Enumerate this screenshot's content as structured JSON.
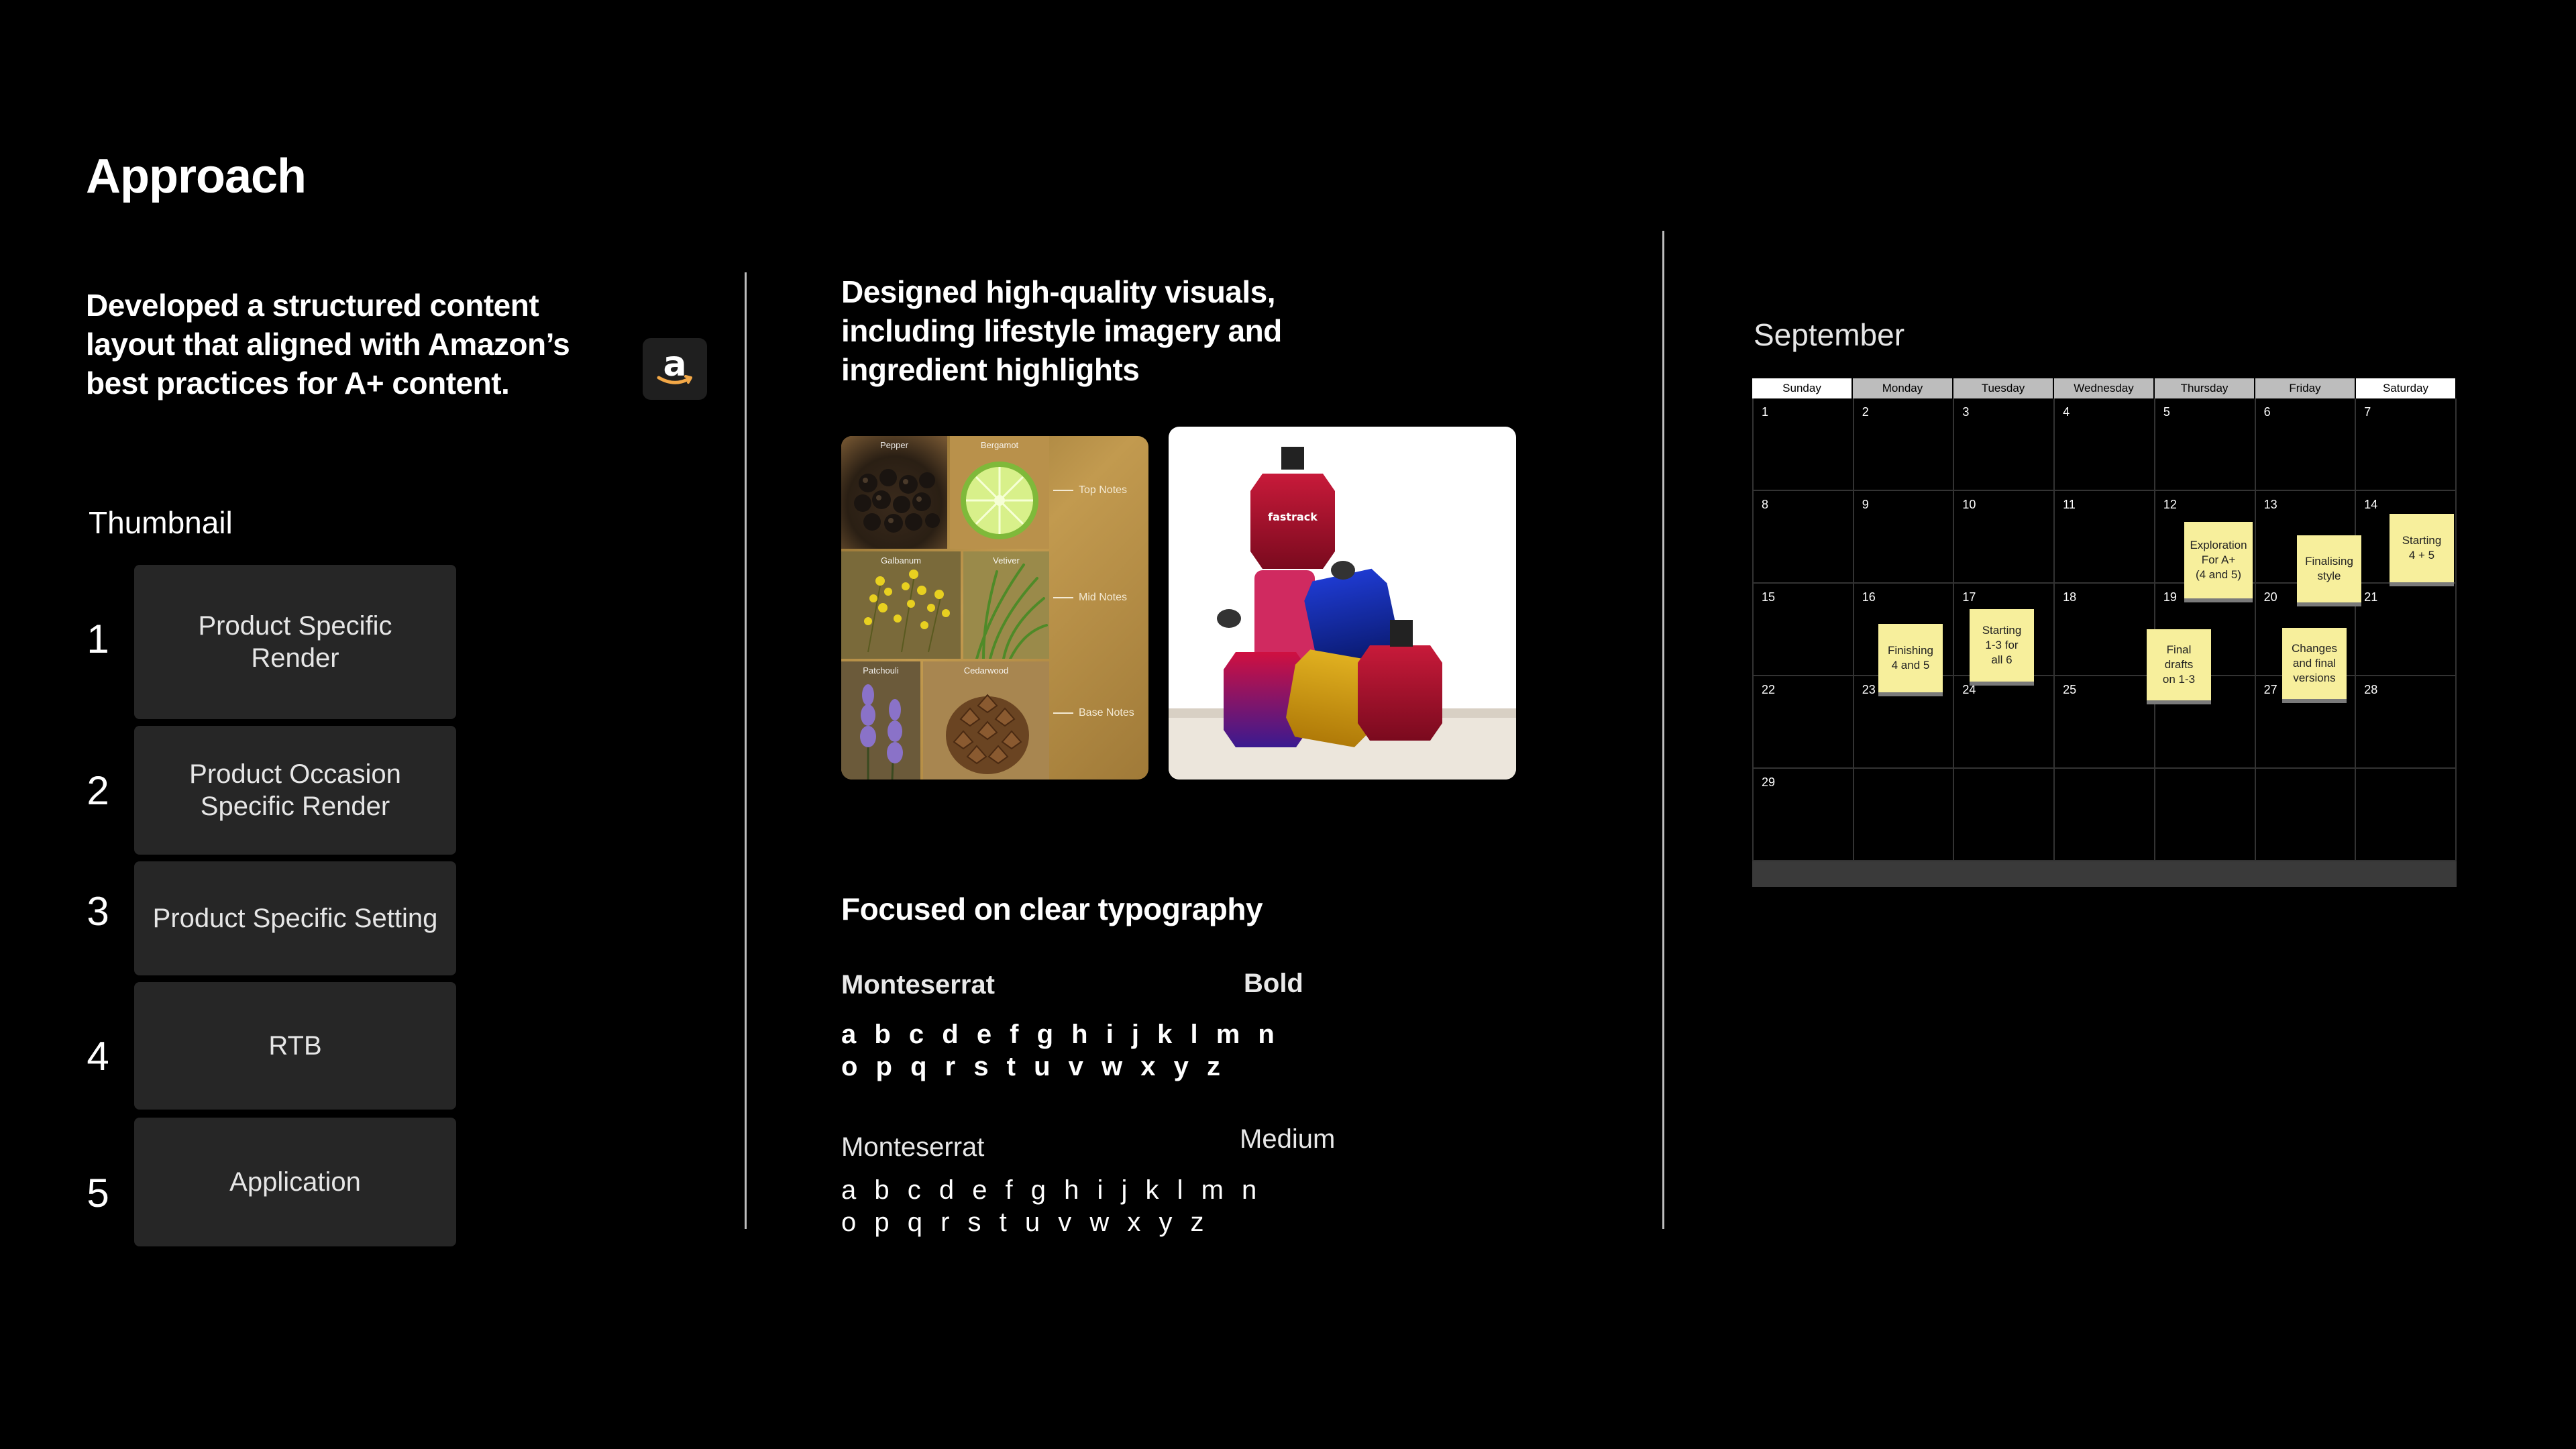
{
  "title": "Approach",
  "left": {
    "heading_lines": [
      "Developed a structured content",
      "layout that aligned with Amazon’s",
      "best practices for A+ content."
    ],
    "badge_icon": "amazon-logo-icon",
    "badge_letter": "a",
    "thumbnail_label": "Thumbnail",
    "items": [
      {
        "num": "1",
        "lines": [
          "Product Specific",
          "Render"
        ]
      },
      {
        "num": "2",
        "lines": [
          "Product Occasion",
          "Specific Render"
        ]
      },
      {
        "num": "3",
        "lines": [
          "Product Specific Setting"
        ]
      },
      {
        "num": "4",
        "lines": [
          "RTB"
        ]
      },
      {
        "num": "5",
        "lines": [
          "Application"
        ]
      }
    ]
  },
  "middle": {
    "heading_lines": [
      "Designed high-quality visuals,",
      "including lifestyle imagery and",
      "ingredient highlights"
    ],
    "ingredient_labels": [
      "Pepper",
      "Bergamot",
      "Galbanum",
      "Vetiver",
      "Patchouli",
      "Cedarwood"
    ],
    "notes": [
      "Top Notes",
      "Mid Notes",
      "Base Notes"
    ],
    "product_brand": "fastrack",
    "typography_heading": "Focused on clear typography",
    "font1": {
      "name": "Monteserrat",
      "weight": "Bold",
      "line1": "a b c d e f g h i j k l m n",
      "line2": "o p q r s t u v w x y z"
    },
    "font2": {
      "name": "Monteserrat",
      "weight": "Medium",
      "line1": "a b c d e f g h i j k l m n",
      "line2": "o p q r s t u v w x y z"
    }
  },
  "calendar": {
    "month": "September",
    "weekdays": [
      "Sunday",
      "Monday",
      "Tuesday",
      "Wednesday",
      "Thursday",
      "Friday",
      "Saturday"
    ],
    "days": [
      "1",
      "2",
      "3",
      "4",
      "5",
      "6",
      "7",
      "8",
      "9",
      "10",
      "11",
      "12",
      "13",
      "14",
      "15",
      "16",
      "17",
      "18",
      "19",
      "20",
      "21",
      "22",
      "23",
      "24",
      "25",
      "26",
      "27",
      "28",
      "29",
      "",
      "",
      "",
      "",
      "",
      ""
    ],
    "notes": [
      {
        "lines": [
          "Exploration",
          "For A+",
          "(4 and 5)"
        ]
      },
      {
        "lines": [
          "Finalising",
          "style"
        ]
      },
      {
        "lines": [
          "Starting",
          "4 + 5"
        ]
      },
      {
        "lines": [
          "Finishing",
          "4 and 5"
        ]
      },
      {
        "lines": [
          "Starting",
          "1-3 for",
          "all 6"
        ]
      },
      {
        "lines": [
          "Final",
          "drafts",
          "on 1-3"
        ]
      },
      {
        "lines": [
          "Changes",
          "and final",
          "versions"
        ]
      }
    ]
  },
  "colors": {
    "background": "#000000",
    "card": "#262626",
    "sticky": "#f7ef9c",
    "divider": "#bdbdbd"
  }
}
